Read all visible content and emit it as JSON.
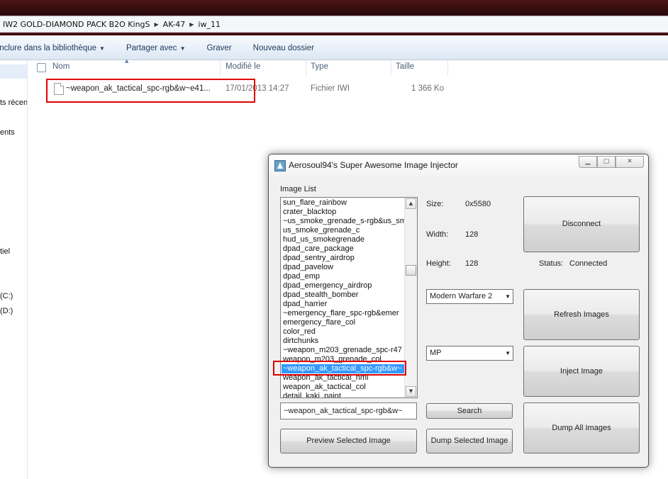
{
  "explorer": {
    "breadcrumb": [
      "IW2 GOLD-DIAMOND PACK B2O KingS",
      "AK-47",
      "iw_11"
    ],
    "commands": [
      {
        "label": "Inclure dans la bibliothèque",
        "dropdown": true
      },
      {
        "label": "Partager avec",
        "dropdown": true
      },
      {
        "label": "Graver",
        "dropdown": false
      },
      {
        "label": "Nouveau dossier",
        "dropdown": false
      }
    ],
    "nav_items": [
      "ts récen",
      "ents",
      "tiel",
      "(C:)",
      "(D:)"
    ],
    "columns": {
      "name": "Nom",
      "modified": "Modifié le",
      "type": "Type",
      "size": "Taille"
    },
    "file": {
      "name": "~weapon_ak_tactical_spc-rgb&w~e41...",
      "modified": "17/01/2013 14:27",
      "type": "Fichier IWI",
      "size": "1 366 Ko"
    }
  },
  "injector": {
    "title": "Aerosoul94's Super Awesome Image Injector",
    "image_list_label": "Image List",
    "images": [
      "sun_flare_rainbow",
      "crater_blacktop",
      "~us_smoke_grenade_s-rgb&us_sm",
      "us_smoke_grenade_c",
      "hud_us_smokegrenade",
      "dpad_care_package",
      "dpad_sentry_airdrop",
      "dpad_pavelow",
      "dpad_emp",
      "dpad_emergency_airdrop",
      "dpad_stealth_bomber",
      "dpad_harrier",
      "~emergency_flare_spc-rgb&emer",
      "emergency_flare_col",
      "color_red",
      "dirtchunks",
      "~weapon_m203_grenade_spc-r47",
      "weapon_m203_grenade_col",
      "~weapon_ak_tactical_spc-rgb&w~",
      "weapon_ak_tactical_nml",
      "weapon_ak_tactical_col",
      "detail_kaki_paint"
    ],
    "selected_index": 18,
    "size_label": "Size:",
    "size_value": "0x5580",
    "width_label": "Width:",
    "width_value": "128",
    "height_label": "Height:",
    "height_value": "128",
    "status_label": "Status:",
    "status_value": "Connected",
    "game_select": "Modern Warfare 2",
    "mode_select": "MP",
    "search_text": "~weapon_ak_tactical_spc-rgb&w~",
    "buttons": {
      "disconnect": "Disconnect",
      "refresh": "Refresh Images",
      "inject": "Inject Image",
      "dump_all": "Dump All Images",
      "search": "Search",
      "dump_selected": "Dump Selected Image",
      "preview": "Preview Selected Image"
    }
  }
}
